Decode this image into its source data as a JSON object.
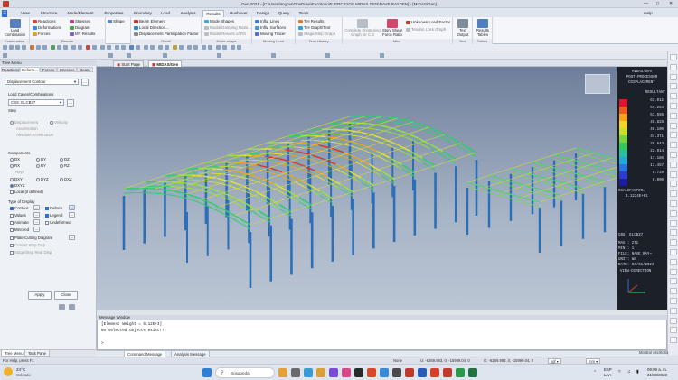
{
  "window": {
    "title": "Gen 2021 - [C:\\Users\\Ingma\\OneDrive\\Escritorio\\EJERCICIOS MIDAS GEN\\NAVE RAYDEN] - [MIDAS/Gen]",
    "help_label": "Help"
  },
  "menu_tabs": [
    "View",
    "Structure",
    "Node/Element",
    "Properties",
    "Boundary",
    "Load",
    "Analysis",
    "Results",
    "Pushover",
    "Design",
    "Query",
    "Tools"
  ],
  "active_menu_tab": "Results",
  "ribbon": {
    "combination": {
      "big_label": "Load Combination",
      "group_label": "Combination"
    },
    "results_group": {
      "items": [
        "Reactions",
        "Deformations",
        "Forces",
        "Stresses",
        "Diagram",
        "MY Results"
      ],
      "group_label": "Results"
    },
    "shape": {
      "label": "Shape"
    },
    "detail": {
      "items": [
        "Beam Element",
        "Local Direction...",
        "Displacement Participation Factor"
      ],
      "group_label": "Detail"
    },
    "mode_shape": {
      "items": [
        "Mode Shapes",
        "Modal Damping Ratio...",
        "Modal Results of RS"
      ],
      "group_label": "Mode shape"
    },
    "moving_load": {
      "items": [
        "Influ. Lines",
        "Influ. Surfaces",
        "Moving Tracer"
      ],
      "group_label": "Moving Load"
    },
    "time_history": {
      "items": [
        "T.H Results",
        "T.H Graph/Text",
        "Stage/Step Graph"
      ],
      "group_label": "Time History"
    },
    "misc": {
      "items": [
        "Complete Shortening Graph for C.S",
        "Story Shear Force Ratio",
        "Unknown Load Factor",
        "Tendon Loss Graph"
      ],
      "group_label": "Misc."
    },
    "text": {
      "big_label": "Text Output",
      "group_label": "Text"
    },
    "tables": {
      "big_label": "Results Tables",
      "group_label": "Tables"
    }
  },
  "left_panel": {
    "title": "Tree Menu",
    "tabs": [
      "Reactions",
      "Deform...",
      "Forces",
      "Stresses",
      "Beam"
    ],
    "active_tab": "Deform...",
    "type_select": "Displacement Contour",
    "load_cases_label": "Load Cases/Combinations",
    "load_case_value": "CBS: ELCB37",
    "step_label": "Step",
    "step_options": [
      "Displacement",
      "Velocity",
      "Acceleration",
      "Absolute Acceleration"
    ],
    "components_label": "Components",
    "components": [
      "DX",
      "DY",
      "DZ",
      "RX",
      "RY",
      "RZ",
      "Rxyz",
      "DXY",
      "DYZ",
      "DXZ",
      "DXYZ"
    ],
    "selected_component": "DXYZ",
    "local_if_defined": "Local (if defined)",
    "type_of_display_label": "Type of Display",
    "display_options": [
      {
        "label": "Contour",
        "checked": true
      },
      {
        "label": "Deform",
        "checked": true
      },
      {
        "label": "Values",
        "checked": false
      },
      {
        "label": "Legend",
        "checked": true
      },
      {
        "label": "Animate",
        "checked": false
      },
      {
        "label": "Undeformed",
        "checked": false
      },
      {
        "label": "Mirrored",
        "checked": false
      }
    ],
    "extra_options": [
      "Plate Cutting Diagram",
      "Current Step Disp.",
      "Stage/Step Real Disp."
    ],
    "apply_label": "Apply",
    "close_label": "Close",
    "bottom_tabs": [
      "Tree Menu",
      "Task Pane"
    ]
  },
  "doc_tabs": [
    "Start Page",
    "MIDAS/Gen"
  ],
  "active_doc_tab": "MIDAS/Gen",
  "legend": {
    "header_lines": [
      "MIDAS/Gen",
      "POST-PROCESSOR",
      "DISPLACEMENT"
    ],
    "result_label": "RESULTANT",
    "values": [
      "63.012",
      "57.284",
      "51.556",
      "45.828",
      "40.100",
      "34.371",
      "28.643",
      "22.914",
      "17.186",
      "11.457",
      "5.729",
      "0.000"
    ],
    "colors": [
      "#e0142c",
      "#f05a1c",
      "#f6a21a",
      "#f3d624",
      "#c8e02a",
      "#78d43a",
      "#34c85a",
      "#28c0a0",
      "#22a8d8",
      "#2c72e0",
      "#2c3cd0",
      "#1c1ca0"
    ],
    "scale_label": "SCALEFACTOR=",
    "scale_value": "3.1224E+01",
    "info_lines": [
      "CBS: ELCB37",
      "MAX : 271",
      "MIN : 1",
      "FILE: NAVE RAY~",
      "UNIT: mm",
      "DATE: 03/31/2023"
    ],
    "view_direction_label": "VIEW-DIRECTION"
  },
  "message_window": {
    "title": "Message Window",
    "lines": [
      "[Element Weight = 6.12E+3]",
      "No selected objects exist!!!",
      "",
      ">"
    ],
    "tabs": [
      "Command Message",
      "Analysis Message"
    ],
    "active_tab": "Command Message"
  },
  "status_bar": {
    "help_text": "For Help, press F1",
    "node": "None",
    "coord1": "U: -6269.993, 0, -15999.04, 0",
    "coord2": "G: -6269.993, 0, -15999.04, 0",
    "unit_force": "kgf",
    "unit_length": "mm",
    "right_label": "Mostrar escritorio"
  },
  "taskbar": {
    "weather_temp": "24°C",
    "weather_desc": "Soleado",
    "search_placeholder": "Búsqueda",
    "lang": "ESP",
    "lang2": "LAA",
    "time": "09:09 a. m.",
    "date": "31/03/2023"
  }
}
